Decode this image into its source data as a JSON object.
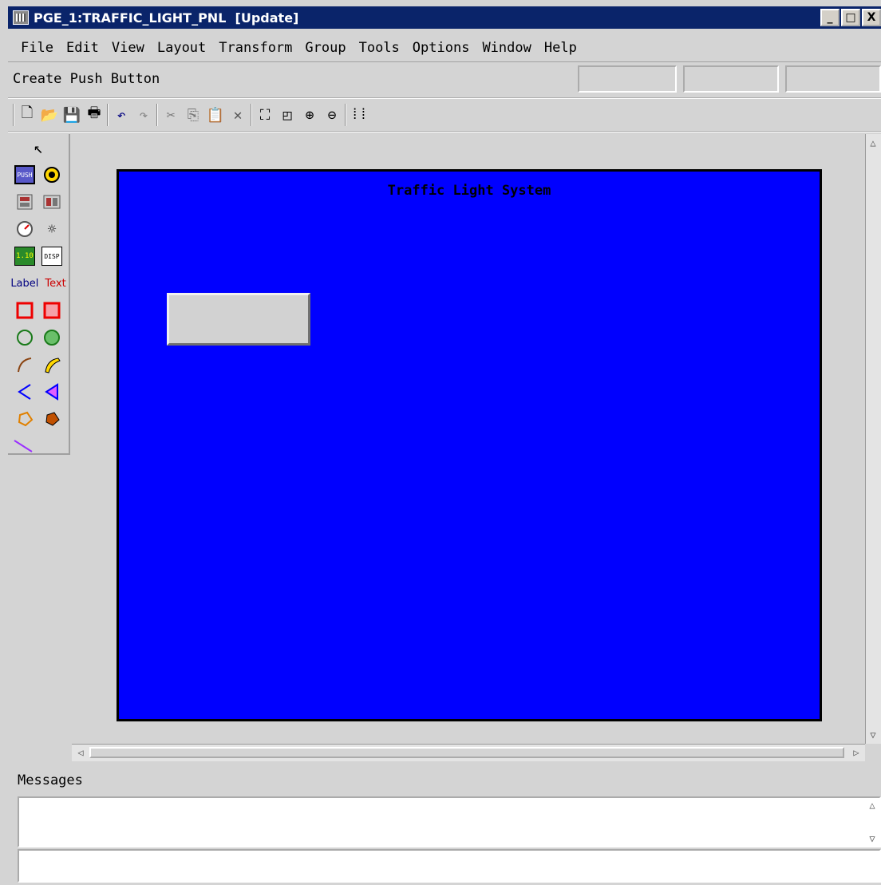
{
  "window": {
    "title": "PGE_1:TRAFFIC_LIGHT_PNL  [Update]",
    "minimize": "_",
    "maximize": "□",
    "close": "X"
  },
  "menu": [
    "File",
    "Edit",
    "View",
    "Layout",
    "Transform",
    "Group",
    "Tools",
    "Options",
    "Window",
    "Help"
  ],
  "status": {
    "text": "Create Push Button"
  },
  "palette": {
    "label_tool": "Label",
    "text_tool": "Text",
    "push_tool": "PUSH",
    "disp_tool": "DISP"
  },
  "canvas": {
    "background": "#0000ff",
    "title": "Traffic Light System"
  },
  "messages": {
    "label": "Messages"
  }
}
